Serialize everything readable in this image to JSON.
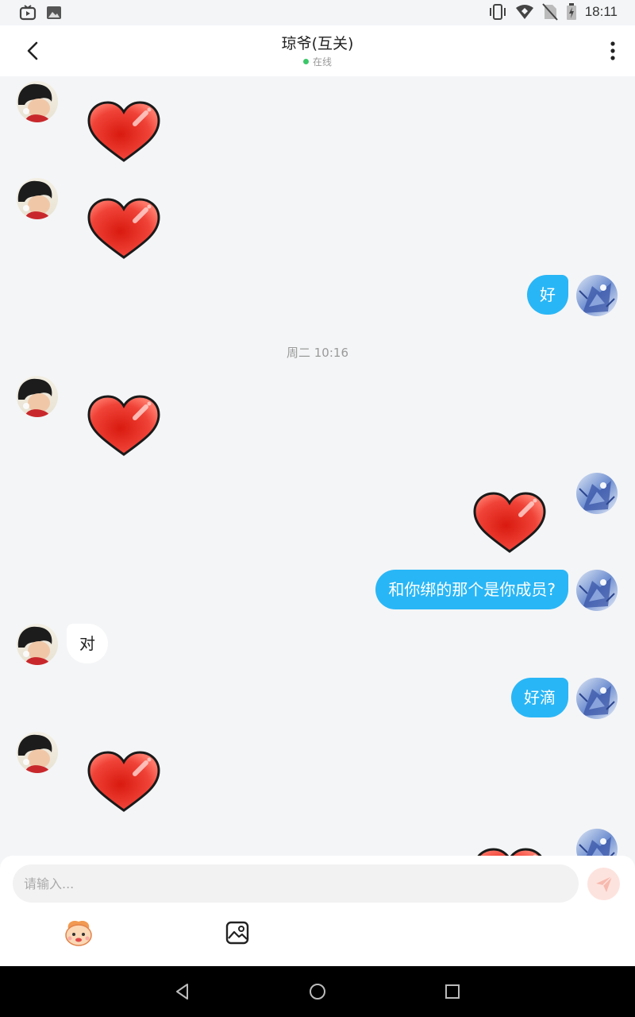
{
  "status_bar": {
    "time": "18:11",
    "left_icons": [
      "tv-icon",
      "image-icon"
    ],
    "right_icons": [
      "vibrate-icon",
      "wifi-icon",
      "no-sim-icon",
      "battery-icon"
    ]
  },
  "header": {
    "title": "琼爷(互关)",
    "status": "在线",
    "back_icon": "back-arrow-icon",
    "more_icon": "more-vertical-icon"
  },
  "messages": [
    {
      "side": "them",
      "type": "sticker",
      "sticker": "red-heart"
    },
    {
      "side": "them",
      "type": "sticker",
      "sticker": "red-heart"
    },
    {
      "side": "me",
      "type": "text",
      "text": "好"
    },
    {
      "type": "timestamp",
      "text": "周二 10:16"
    },
    {
      "side": "them",
      "type": "sticker",
      "sticker": "red-heart"
    },
    {
      "side": "me",
      "type": "sticker",
      "sticker": "red-heart"
    },
    {
      "side": "me",
      "type": "text",
      "text": "和你绑的那个是你成员?"
    },
    {
      "side": "them",
      "type": "text",
      "text": "对"
    },
    {
      "side": "me",
      "type": "text",
      "text": "好滴"
    },
    {
      "side": "them",
      "type": "sticker",
      "sticker": "red-heart"
    },
    {
      "side": "me",
      "type": "sticker",
      "sticker": "red-heart"
    }
  ],
  "composer": {
    "placeholder": "请输入...",
    "send_icon": "send-icon",
    "emoji_icon": "emoji-sticker-icon",
    "image_icon": "image-picker-icon"
  },
  "colors": {
    "my_bubble": "#29b6f6",
    "their_bubble": "#ffffff",
    "online_dot": "#3cc76a",
    "heart": "#e8342a",
    "send_button_bg": "#fde3de"
  }
}
